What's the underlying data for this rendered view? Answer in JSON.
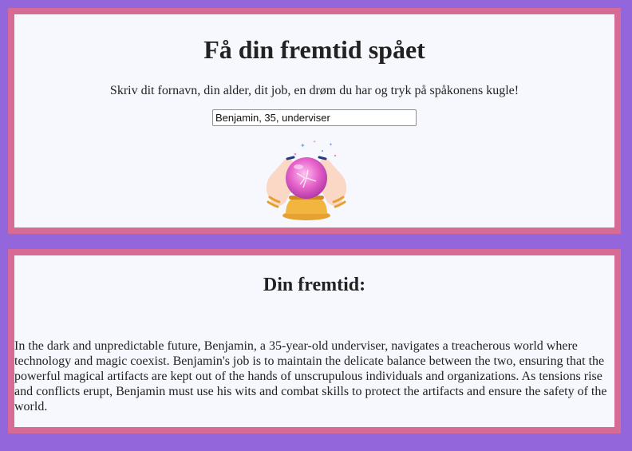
{
  "header": {
    "title": "Få din fremtid spået",
    "instructions": "Skriv dit fornavn, din alder, dit job, en drøm du har og tryk på spåkonens kugle!"
  },
  "form": {
    "input_value": "Benjamin, 35, underviser",
    "ball_icon": "crystal-ball-hands-icon"
  },
  "result": {
    "heading": "Din fremtid:",
    "text": "In the dark and unpredictable future, Benjamin, a 35-year-old underviser, navigates a treacherous world where technology and magic coexist. Benjamin's job is to maintain the delicate balance between the two, ensuring that the powerful magical artifacts are kept out of the hands of unscrupulous individuals and organizations. As tensions rise and conflicts erupt, Benjamin must use his wits and combat skills to protect the artifacts and ensure the safety of the world."
  },
  "colors": {
    "page_background": "#9466db",
    "panel_border": "#d66b95",
    "panel_background": "#f7f8fd"
  }
}
